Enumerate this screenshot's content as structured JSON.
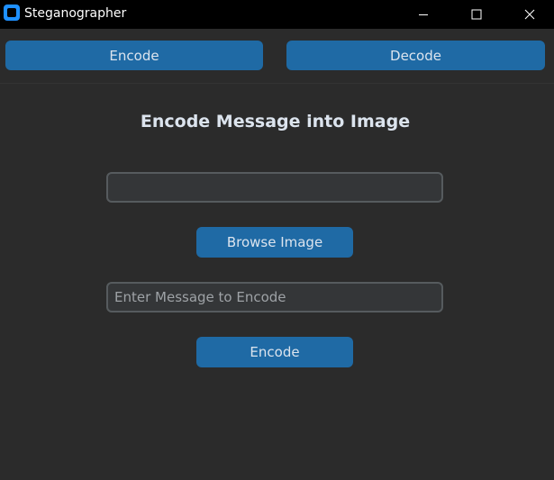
{
  "window": {
    "title": "Steganographer",
    "icons": {
      "app": "app-icon",
      "minimize": "minimize-icon",
      "maximize": "maximize-icon",
      "close": "close-icon"
    }
  },
  "nav": {
    "encode_label": "Encode",
    "decode_label": "Decode"
  },
  "main": {
    "heading": "Encode Message into Image",
    "image_path": {
      "value": "",
      "placeholder": ""
    },
    "browse_label": "Browse Image",
    "message": {
      "value": "",
      "placeholder": "Enter Message to Encode"
    },
    "submit_label": "Encode"
  },
  "colors": {
    "titlebar": "#000000",
    "background": "#2b2b2b",
    "button": "#1f6aa5",
    "button_text": "#dce4ee",
    "field_bg": "#343638",
    "field_border": "#565b5e",
    "placeholder": "#9ea2a6"
  }
}
